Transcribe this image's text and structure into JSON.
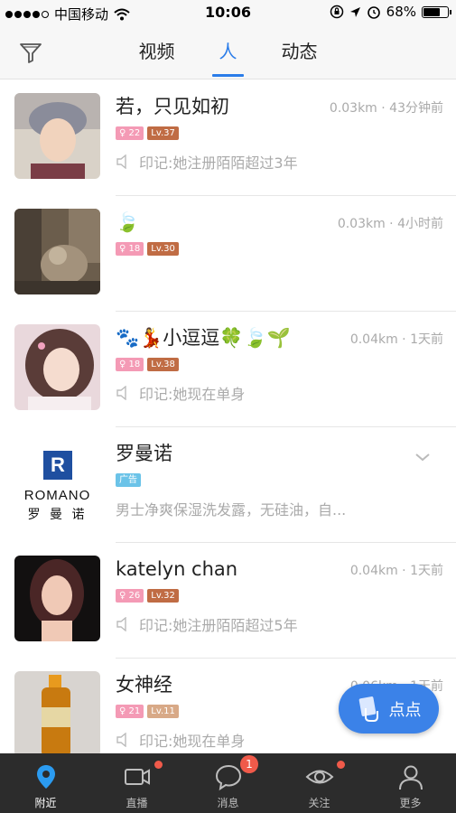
{
  "status": {
    "carrier": "中国移动",
    "time": "10:06",
    "battery": "68%"
  },
  "nav": {
    "tabs": [
      "视频",
      "人",
      "动态"
    ],
    "active_tab": "人"
  },
  "people": [
    {
      "name": "若，只见如初",
      "distance_time": "0.03km · 43分钟前",
      "age": "22",
      "level": "Lv.37",
      "imprint": "印记:她注册陌陌超过3年"
    },
    {
      "name": "🍃",
      "distance_time": "0.03km · 4小时前",
      "age": "18",
      "level": "Lv.30",
      "imprint": ""
    },
    {
      "name": "🐾💃小逗逗🍀🍃🌱",
      "distance_time": "0.04km · 1天前",
      "age": "18",
      "level": "Lv.38",
      "imprint": "印记:她现在单身"
    },
    {
      "name": "罗曼诺",
      "ad_label": "广告",
      "description": "男士净爽保湿洗发露，无硅油，自...",
      "logo_top": "ROMANO",
      "logo_bottom": "罗 曼 诺",
      "logo_mark": "R"
    },
    {
      "name": "katelyn chan",
      "distance_time": "0.04km · 1天前",
      "age": "26",
      "level": "Lv.32",
      "imprint": "印记:她注册陌陌超过5年"
    },
    {
      "name": "女神经",
      "distance_time": "0.06km · 1天前",
      "age": "21",
      "level": "Lv.11",
      "imprint": "印记:她现在单身"
    }
  ],
  "fab": {
    "label": "点点"
  },
  "tabbar": {
    "items": [
      {
        "label": "附近",
        "icon": "location-pin-icon",
        "active": true
      },
      {
        "label": "直播",
        "icon": "video-camera-icon"
      },
      {
        "label": "消息",
        "icon": "chat-bubble-icon",
        "badge": "1"
      },
      {
        "label": "关注",
        "icon": "eye-icon"
      },
      {
        "label": "更多",
        "icon": "person-icon"
      }
    ]
  },
  "colors": {
    "accent": "#2b7de9",
    "badge_pink": "#f49ab5",
    "badge_level": "#c06c44",
    "badge_ad": "#6bc3e8",
    "tabbar_bg": "#2c2c2c",
    "notification_red": "#f05a4a"
  }
}
